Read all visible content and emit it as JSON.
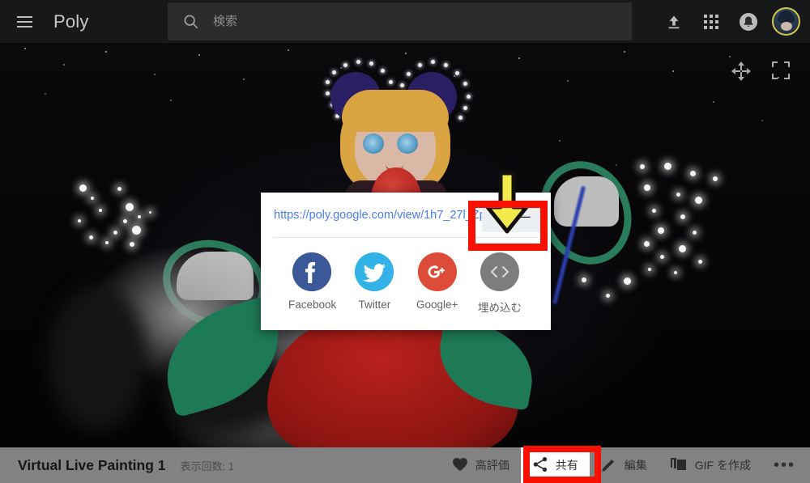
{
  "header": {
    "menu_icon": "hamburger-menu-icon",
    "brand": "Poly",
    "search": {
      "icon": "search-icon",
      "value": "",
      "placeholder": "検索"
    },
    "actions": [
      {
        "icon": "upload-icon",
        "label": "アップロード"
      },
      {
        "icon": "apps-grid-icon",
        "label": "Google アプリ"
      },
      {
        "icon": "notifications-bell-icon",
        "label": "通知"
      }
    ],
    "avatar": {
      "icon": "user-avatar",
      "label": "アカウント"
    }
  },
  "viewer": {
    "controls": [
      {
        "icon": "pan-move-icon",
        "label": "移動"
      },
      {
        "icon": "fullscreen-icon",
        "label": "全画面表示"
      }
    ],
    "annotation": {
      "arrow_icon": "yellow-down-arrow",
      "arrow_color": "#f2ea4c",
      "highlight_color": "#f81000"
    }
  },
  "share_dialog": {
    "url": "https://poly.google.com/view/1h7_27l_Zp",
    "copy_label": "コピー",
    "socials": [
      {
        "name": "facebook",
        "label": "Facebook",
        "color": "#3b5998",
        "glyph": "f"
      },
      {
        "name": "twitter",
        "label": "Twitter",
        "color": "#33b2e8",
        "glyph": "twitter-bird-icon"
      },
      {
        "name": "google-plus",
        "label": "Google+",
        "color": "#dd4b39",
        "glyph": "G+"
      },
      {
        "name": "embed",
        "label": "埋め込む",
        "color": "#7d7d7d",
        "glyph": "<>"
      }
    ]
  },
  "bottom_bar": {
    "title": "Virtual Live Painting 1",
    "views": "表示回数: 1",
    "actions": [
      {
        "name": "like",
        "icon": "heart-icon",
        "label": "高評価"
      },
      {
        "name": "share",
        "icon": "share-nodes-icon",
        "label": "共有"
      },
      {
        "name": "edit",
        "icon": "pencil-icon",
        "label": "編集"
      },
      {
        "name": "create-gif",
        "icon": "copy-frames-icon",
        "label": "GIF を作成"
      }
    ],
    "more_label": "•••"
  }
}
